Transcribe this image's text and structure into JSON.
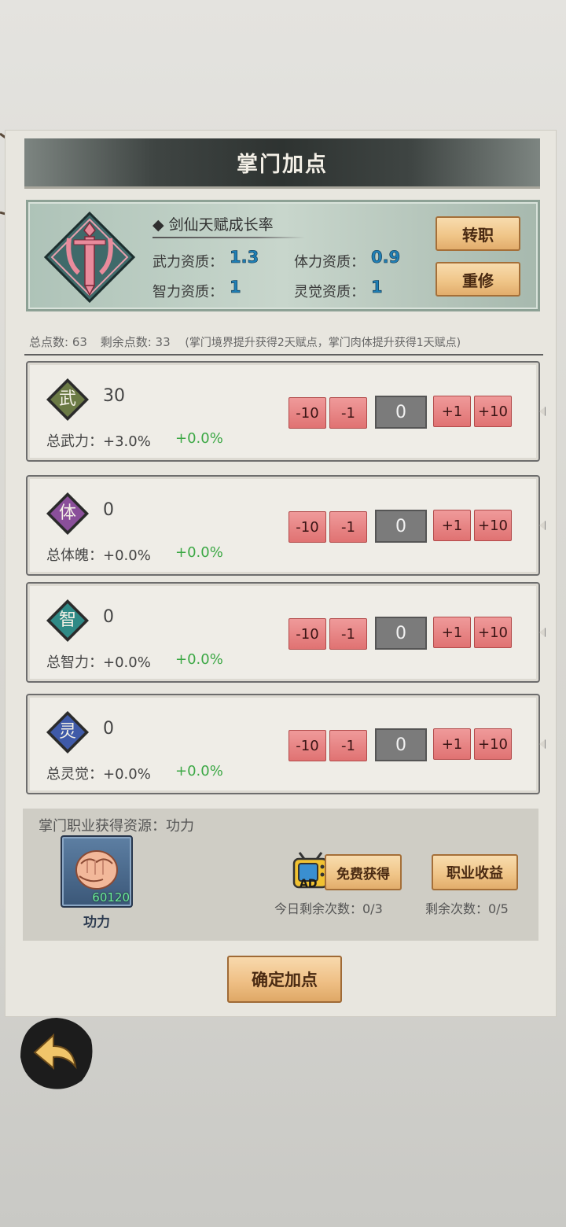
{
  "title": "掌门加点",
  "class_panel": {
    "growth_title": "◆ 剑仙天赋成长率",
    "stats": [
      {
        "label": "武力资质：",
        "value": "1.3"
      },
      {
        "label": "体力资质：",
        "value": "0.9"
      },
      {
        "label": "智力资质：",
        "value": "1"
      },
      {
        "label": "灵觉资质：",
        "value": "1"
      }
    ],
    "transfer_label": "转职",
    "retrain_label": "重修"
  },
  "summary": {
    "total": "总点数: 63",
    "remaining": "剩余点数: 33",
    "note": "(掌门境界提升获得2天赋点，掌门肉体提升获得1天赋点)"
  },
  "steppers": {
    "minus10": "-10",
    "minus1": "-1",
    "plus1": "+1",
    "plus10": "+10"
  },
  "attributes": [
    {
      "glyph": "武",
      "value": "30",
      "total": "总武力：+3.0%",
      "bonus": "+0.0%",
      "alloc": "0",
      "color": "#6b7a45"
    },
    {
      "glyph": "体",
      "value": "0",
      "total": "总体魄：+0.0%",
      "bonus": "+0.0%",
      "alloc": "0",
      "color": "#8a4f9a"
    },
    {
      "glyph": "智",
      "value": "0",
      "total": "总智力：+0.0%",
      "bonus": "+0.0%",
      "alloc": "0",
      "color": "#2f8a86"
    },
    {
      "glyph": "灵",
      "value": "0",
      "total": "总灵觉：+0.0%",
      "bonus": "+0.0%",
      "alloc": "0",
      "color": "#3f5aa8"
    }
  ],
  "resource": {
    "title": "掌门职业获得资源：功力",
    "item_count": "60120",
    "item_name": "功力",
    "ad_text": "AD",
    "free_label": "免费获得",
    "free_remaining": "今日剩余次数：0/3",
    "career_label": "职业收益",
    "career_remaining": "剩余次数：0/5"
  },
  "confirm_label": "确定加点"
}
